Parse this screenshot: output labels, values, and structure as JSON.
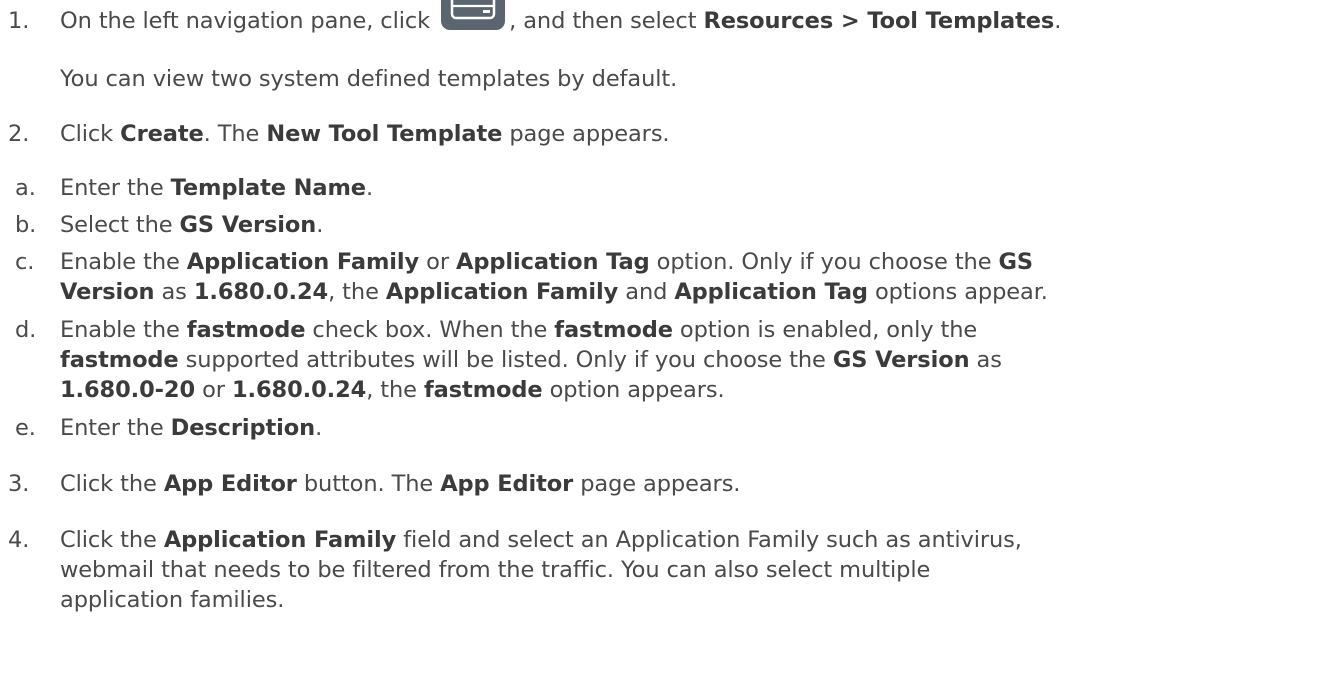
{
  "steps": {
    "s1": {
      "num": "1.",
      "pre": "On the left navigation pane, click ",
      "mid": ", and then select ",
      "b1": "Resources > Tool Templates",
      "post": ".",
      "sub": "You can view two system defined templates by default.",
      "icon": "server-icon"
    },
    "s2": {
      "num": "2.",
      "t1": "Click ",
      "b1": "Create",
      "t2": ". The ",
      "b2": "New Tool Template",
      "t3": " page appears."
    },
    "sa": {
      "num": "a.",
      "t1": "Enter the ",
      "b1": "Template Name",
      "t2": "."
    },
    "sb": {
      "num": "b.",
      "t1": "Select the ",
      "b1": "GS Version",
      "t2": "."
    },
    "sc": {
      "num": "c.",
      "t1": "Enable the ",
      "b1": "Application Family",
      "t2": " or ",
      "b2": "Application Tag",
      "t3": " option. Only if you choose the ",
      "b3": "GS",
      "b4": "Version",
      "t4": " as ",
      "b5": "1.680.0.24",
      "t5": ", the ",
      "b6": "Application Family",
      "t6": " and ",
      "b7": "Application Tag",
      "t7": " options appear."
    },
    "sd": {
      "num": "d.",
      "t1": "Enable the ",
      "b1": "fastmode",
      "t2": " check box. When the ",
      "b2": "fastmode",
      "t3": " option is enabled, only the",
      "b3": "fastmode",
      "t4": " supported attributes will be listed. Only if you choose the ",
      "b4": "GS Version",
      "t5": " as",
      "b5": "1.680.0-20",
      "t6": " or ",
      "b6": "1.680.0.24",
      "t7": ", the ",
      "b7": "fastmode",
      "t8": " option appears."
    },
    "se": {
      "num": "e.",
      "t1": "Enter the ",
      "b1": "Description",
      "t2": "."
    },
    "s3": {
      "num": "3.",
      "t1": "Click the ",
      "b1": "App Editor",
      "t2": " button. The ",
      "b2": "App Editor",
      "t3": " page appears."
    },
    "s4": {
      "num": "4.",
      "t1": "Click the ",
      "b1": "Application Family",
      "l1": " field and select an Application Family such as antivirus,",
      "l2": "webmail that needs to be filtered from the traffic. You can also select multiple",
      "l3": "application families."
    }
  },
  "colors": {
    "text": "#4a4a4a",
    "bold": "#3b3b3b",
    "icon_bg": "#5a6570"
  }
}
